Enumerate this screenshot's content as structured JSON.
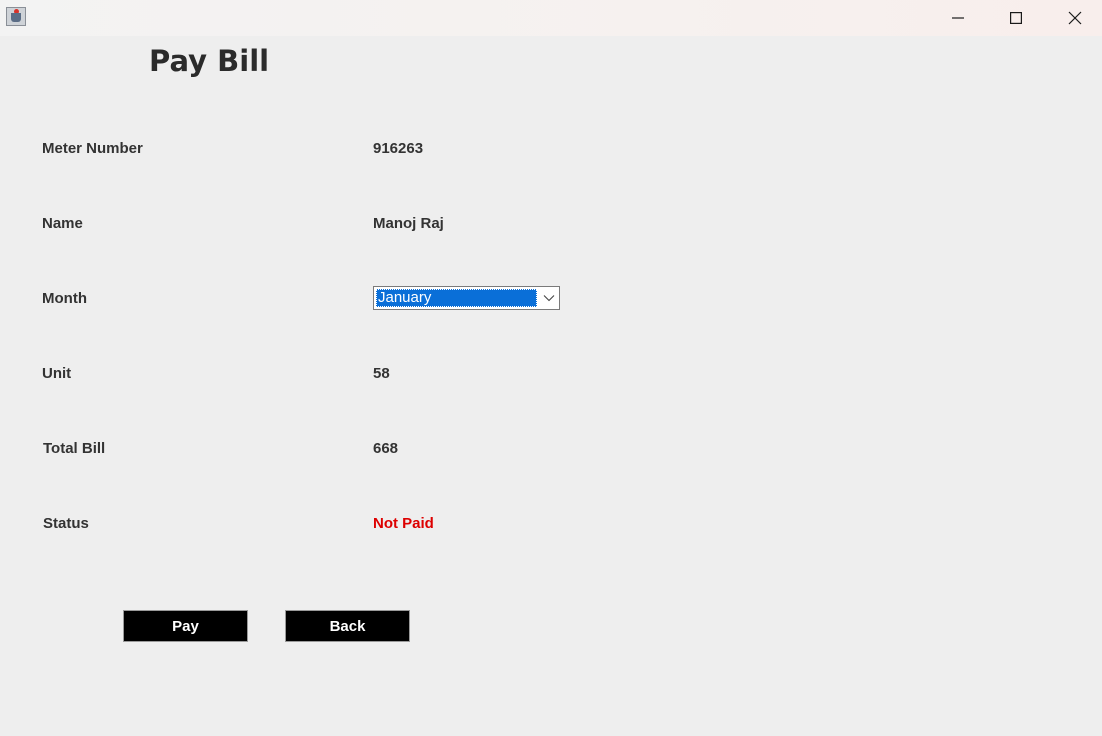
{
  "window": {
    "app_icon": "java-cup-icon",
    "controls": {
      "minimize": "minimize-icon",
      "maximize": "maximize-icon",
      "close": "close-icon"
    }
  },
  "page": {
    "title": "Pay Bill"
  },
  "fields": {
    "meter_number": {
      "label": "Meter Number",
      "value": "916263"
    },
    "name": {
      "label": "Name",
      "value": "Manoj Raj"
    },
    "month": {
      "label": "Month",
      "selected": "January"
    },
    "unit": {
      "label": "Unit",
      "value": "58"
    },
    "total_bill": {
      "label": "Total Bill",
      "value": "668"
    },
    "status": {
      "label": "Status",
      "value": "Not Paid",
      "color": "#dd0000"
    }
  },
  "buttons": {
    "pay": "Pay",
    "back": "Back"
  },
  "colors": {
    "background": "#eeeeee",
    "selection": "#0a6fd8",
    "button_bg": "#000000",
    "button_text": "#ffffff"
  }
}
